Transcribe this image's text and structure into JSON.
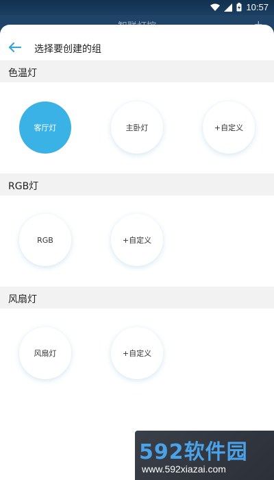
{
  "status_bar": {
    "time": "10:57"
  },
  "behind": {
    "title": "智联灯控",
    "add": "+"
  },
  "sheet": {
    "title": "选择要创建的组"
  },
  "sections": [
    {
      "label": "色温灯",
      "items": [
        "客厅灯",
        "主卧灯",
        "+自定义"
      ],
      "selected": "客厅灯"
    },
    {
      "label": "RGB灯",
      "items": [
        "RGB",
        "+自定义"
      ]
    },
    {
      "label": "风扇灯",
      "items": [
        "风扇灯",
        "+自定义"
      ]
    }
  ],
  "colors": {
    "accent": "#3bb2e6",
    "back_arrow": "#3aa3dc"
  },
  "watermark": {
    "brand": "592软件园",
    "url": "www.592xiazai.com"
  }
}
